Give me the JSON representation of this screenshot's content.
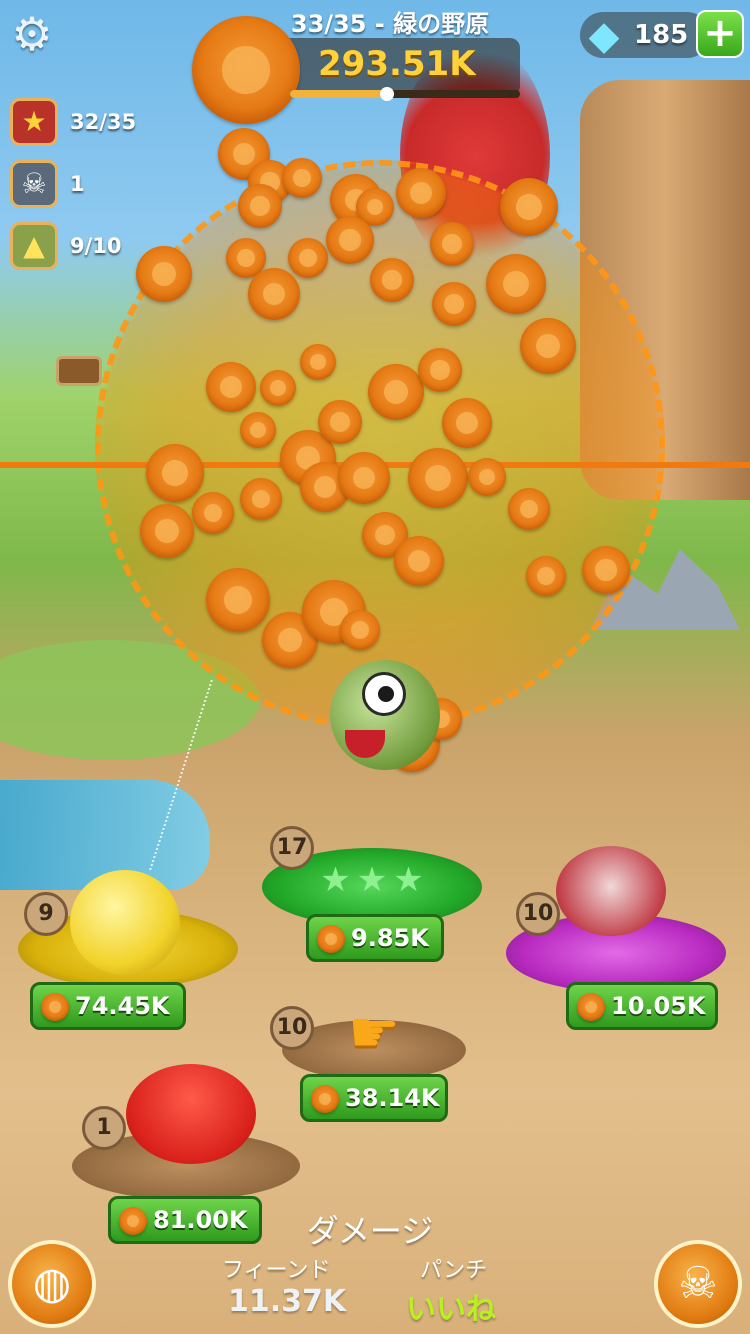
{
  "hud": {
    "level_label": "33/35 - 緑の野原",
    "coin_total": "293.51K",
    "level_progress_fraction": 0.42,
    "gems": "185"
  },
  "stats": {
    "stage": "32/35",
    "kills": "1",
    "heroes": "9/10"
  },
  "heroes": [
    {
      "level": "9",
      "cost": "74.45K"
    },
    {
      "level": "17",
      "cost": "9.85K"
    },
    {
      "level": "10",
      "cost": "10.05K"
    },
    {
      "level": "10",
      "cost": "38.14K"
    },
    {
      "level": "1",
      "cost": "81.00K"
    }
  ],
  "damage": {
    "title": "ダメージ",
    "fiend_label": "フィーンド",
    "fiend_value": "11.37K",
    "punch_label": "パンチ",
    "punch_value": "いいね"
  },
  "icons": {
    "settings": "gear-icon",
    "gem": "diamond-icon",
    "plus": "plus-icon",
    "map": "world-map-icon",
    "boss": "skull-crossbones-icon"
  },
  "colors": {
    "coin_text": "#ffd23a",
    "button_green": "#38a81c",
    "accent_orange": "#e07a10",
    "punch_value": "#b8f020"
  }
}
